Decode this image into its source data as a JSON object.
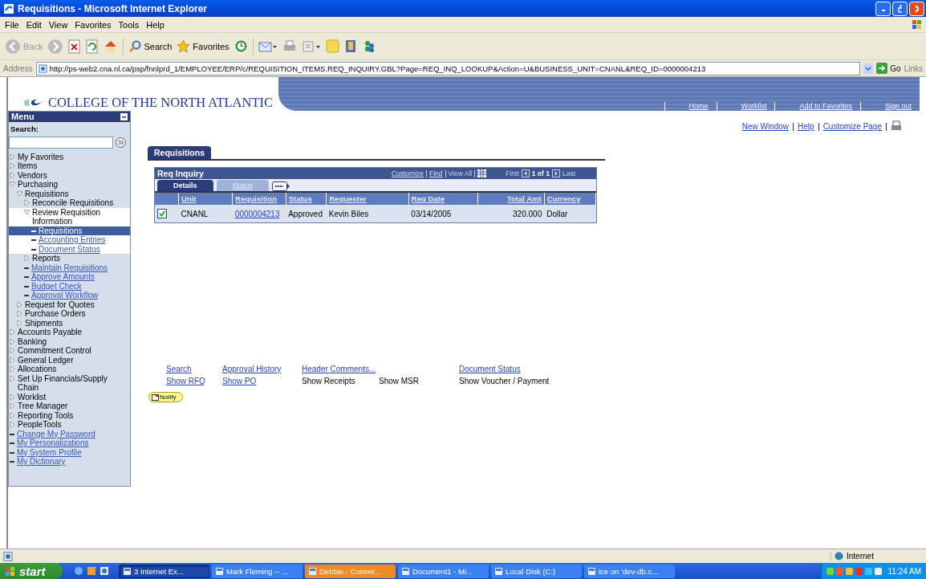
{
  "window": {
    "title": "Requisitions - Microsoft Internet Explorer"
  },
  "menu_bar": [
    "File",
    "Edit",
    "View",
    "Favorites",
    "Tools",
    "Help"
  ],
  "toolbar": {
    "back": "Back",
    "search": "Search",
    "favorites": "Favorites"
  },
  "address_bar": {
    "label": "Address",
    "url": "http://ps-web2.cna.nl.ca/psp/fnnlprd_1/EMPLOYEE/ERP/c/REQUISITION_ITEMS.REQ_INQUIRY.GBL?Page=REQ_INQ_LOOKUP&Action=U&BUSINESS_UNIT=CNANL&REQ_ID=0000004213",
    "go": "Go",
    "links": "Links"
  },
  "header": {
    "logo": "COLLEGE OF THE NORTH ATLANTIC",
    "nav": [
      "Home",
      "Worklist",
      "Add to Favorites",
      "Sign out"
    ]
  },
  "sidebar": {
    "title": "Menu",
    "search_label": "Search:",
    "items": [
      {
        "label": "My Favorites",
        "kind": "folder",
        "expanded": false,
        "selected": false
      },
      {
        "label": "Items",
        "kind": "folder",
        "expanded": false,
        "selected": false
      },
      {
        "label": "Vendors",
        "kind": "folder",
        "expanded": false,
        "selected": false
      },
      {
        "label": "Purchasing",
        "kind": "folder",
        "expanded": true,
        "selected": false,
        "children": [
          {
            "label": "Requisitions",
            "kind": "folder",
            "expanded": true,
            "selected": false,
            "children": [
              {
                "label": "Reconcile Requisitions",
                "kind": "folder",
                "expanded": false,
                "selected": false
              },
              {
                "label": "Review Requisition Information",
                "kind": "folder",
                "expanded": true,
                "selected": false,
                "children": [
                  {
                    "label": "Requisitions",
                    "kind": "link",
                    "selected": true
                  },
                  {
                    "label": "Accounting Entries",
                    "kind": "link",
                    "selected": false
                  },
                  {
                    "label": "Document Status",
                    "kind": "link",
                    "selected": false
                  }
                ]
              },
              {
                "label": "Reports",
                "kind": "folder",
                "expanded": false,
                "selected": false
              },
              {
                "label": "Maintain Requisitions",
                "kind": "link",
                "selected": false
              },
              {
                "label": "Approve Amounts",
                "kind": "link",
                "selected": false
              },
              {
                "label": "Budget Check",
                "kind": "link",
                "selected": false
              },
              {
                "label": "Approval Workflow",
                "kind": "link",
                "selected": false
              }
            ]
          },
          {
            "label": "Request for Quotes",
            "kind": "folder",
            "expanded": false,
            "selected": false
          },
          {
            "label": "Purchase Orders",
            "kind": "folder",
            "expanded": false,
            "selected": false
          },
          {
            "label": "Shipments",
            "kind": "folder",
            "expanded": false,
            "selected": false
          }
        ]
      },
      {
        "label": "Accounts Payable",
        "kind": "folder",
        "expanded": false,
        "selected": false
      },
      {
        "label": "Banking",
        "kind": "folder",
        "expanded": false,
        "selected": false
      },
      {
        "label": "Commitment Control",
        "kind": "folder",
        "expanded": false,
        "selected": false
      },
      {
        "label": "General Ledger",
        "kind": "folder",
        "expanded": false,
        "selected": false
      },
      {
        "label": "Allocations",
        "kind": "folder",
        "expanded": false,
        "selected": false
      },
      {
        "label": "Set Up Financials/Supply Chain",
        "kind": "folder",
        "expanded": false,
        "selected": false
      },
      {
        "label": "Worklist",
        "kind": "folder",
        "expanded": false,
        "selected": false
      },
      {
        "label": "Tree Manager",
        "kind": "folder",
        "expanded": false,
        "selected": false
      },
      {
        "label": "Reporting Tools",
        "kind": "folder",
        "expanded": false,
        "selected": false
      },
      {
        "label": "PeopleTools",
        "kind": "folder",
        "expanded": false,
        "selected": false
      },
      {
        "label": "Change My Password",
        "kind": "link",
        "selected": false
      },
      {
        "label": "My Personalizations",
        "kind": "link",
        "selected": false
      },
      {
        "label": "My System Profile",
        "kind": "link",
        "selected": false
      },
      {
        "label": "My Dictionary",
        "kind": "link",
        "selected": false
      }
    ]
  },
  "page_links": [
    "New Window",
    "Help",
    "Customize Page"
  ],
  "page_tab": "Requisitions",
  "grid": {
    "title": "Req Inquiry",
    "tools": [
      "Customize",
      "Find",
      "View All"
    ],
    "nav": {
      "first": "First",
      "count": "1 of 1",
      "last": "Last"
    },
    "tabs": [
      {
        "label": "Details",
        "selected": true
      },
      {
        "label": "Status",
        "selected": false
      }
    ],
    "columns": [
      "Unit",
      "Requisition",
      "Status",
      "Requester",
      "Req Date",
      "Total Amt",
      "Currency"
    ],
    "rows": [
      {
        "checked": true,
        "cells": [
          "CNANL",
          "0000004213",
          "Approved",
          "Kevin Biles",
          "03/14/2005",
          "320.000",
          "Dollar"
        ]
      }
    ]
  },
  "actions": [
    [
      {
        "label": "Search",
        "kind": "link"
      },
      {
        "label": "Show RFQ",
        "kind": "link"
      }
    ],
    [
      {
        "label": "Approval History",
        "kind": "link"
      },
      {
        "label": "Show PO",
        "kind": "link"
      }
    ],
    [
      {
        "label": "Header Comments...",
        "kind": "link"
      },
      {
        "label": "Show Receipts",
        "kind": "text"
      }
    ],
    [
      {
        "label": "Show MSR",
        "kind": "text"
      }
    ],
    [
      {
        "label": "Document Status",
        "kind": "link"
      },
      {
        "label": "Show Voucher / Payment",
        "kind": "text"
      }
    ]
  ],
  "notify": "Notify",
  "status_bar": {
    "zone": "Internet"
  },
  "taskbar": {
    "start": "start",
    "tasks": [
      {
        "label": "3 Internet Ex...",
        "selected": true,
        "flashing": false
      },
      {
        "label": "Mark Fleming -- ...",
        "selected": false,
        "flashing": false
      },
      {
        "label": "Debbie - Conver...",
        "selected": false,
        "flashing": true
      },
      {
        "label": "Document1 - Mi...",
        "selected": false,
        "flashing": false
      },
      {
        "label": "Local Disk (C:)",
        "selected": false,
        "flashing": false
      },
      {
        "label": "ice on 'dev-db.c...",
        "selected": false,
        "flashing": false
      }
    ],
    "clock": "11:24 AM"
  }
}
